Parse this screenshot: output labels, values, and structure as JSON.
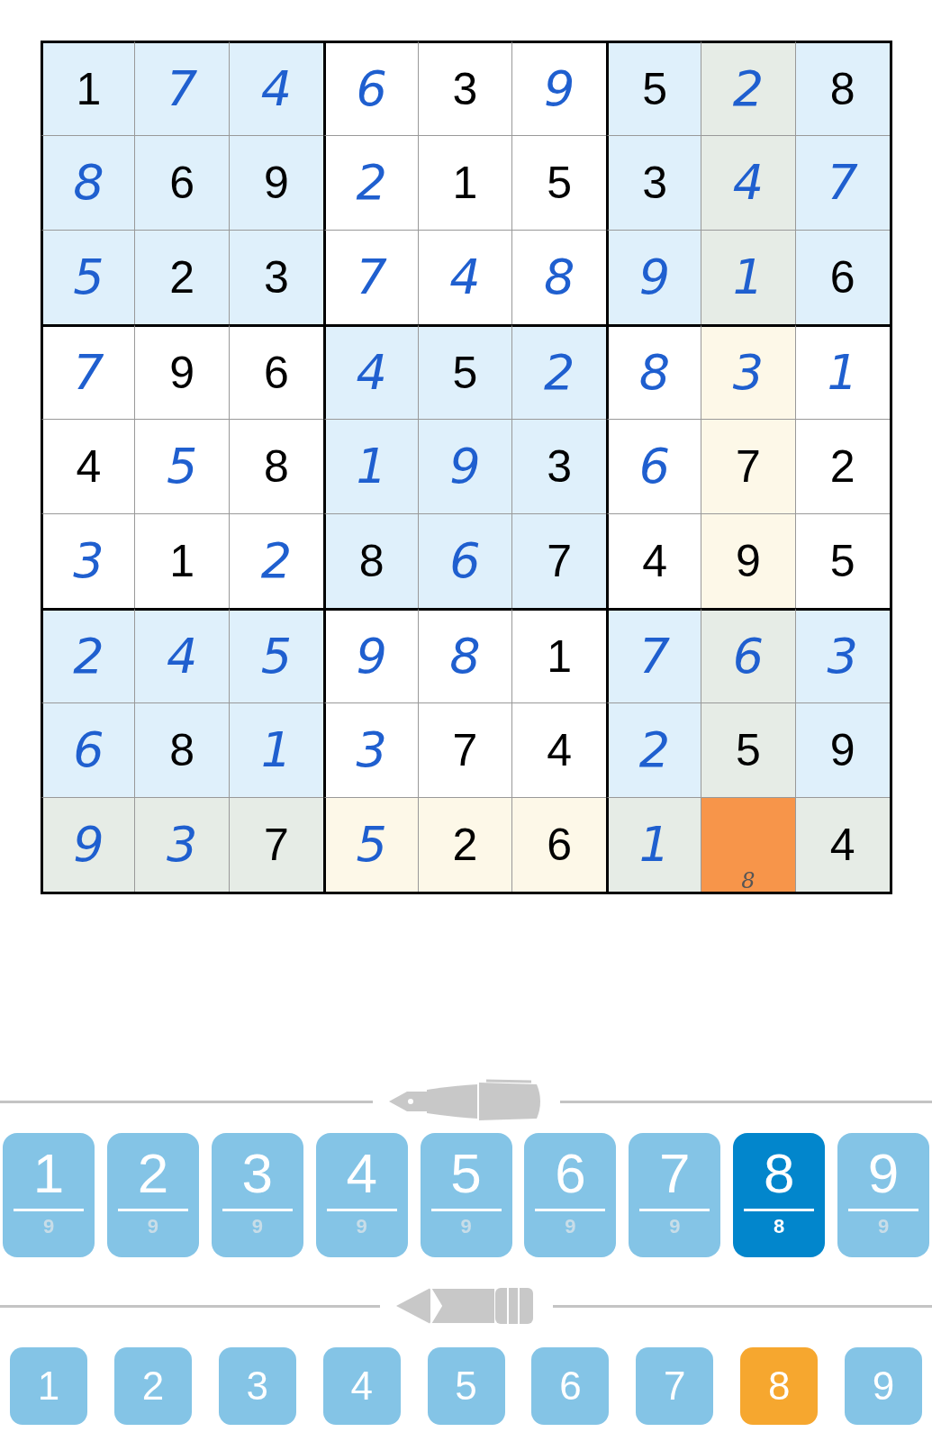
{
  "grid": {
    "rows": [
      {
        "cells": [
          {
            "value": "1",
            "kind": "given",
            "color": "#dff0fb"
          },
          {
            "value": "7",
            "kind": "entered",
            "color": "#dff0fb"
          },
          {
            "value": "4",
            "kind": "entered",
            "color": "#dff0fb"
          },
          {
            "value": "6",
            "kind": "entered",
            "color": "#ffffff"
          },
          {
            "value": "3",
            "kind": "given",
            "color": "#ffffff"
          },
          {
            "value": "9",
            "kind": "entered",
            "color": "#ffffff"
          },
          {
            "value": "5",
            "kind": "given",
            "color": "#dff0fb"
          },
          {
            "value": "2",
            "kind": "entered",
            "color": "#e6ece6"
          },
          {
            "value": "8",
            "kind": "given",
            "color": "#dff0fb"
          }
        ]
      },
      {
        "cells": [
          {
            "value": "8",
            "kind": "entered",
            "color": "#dff0fb"
          },
          {
            "value": "6",
            "kind": "given",
            "color": "#dff0fb"
          },
          {
            "value": "9",
            "kind": "given",
            "color": "#dff0fb"
          },
          {
            "value": "2",
            "kind": "entered",
            "color": "#ffffff"
          },
          {
            "value": "1",
            "kind": "given",
            "color": "#ffffff"
          },
          {
            "value": "5",
            "kind": "given",
            "color": "#ffffff"
          },
          {
            "value": "3",
            "kind": "given",
            "color": "#dff0fb"
          },
          {
            "value": "4",
            "kind": "entered",
            "color": "#e6ece6"
          },
          {
            "value": "7",
            "kind": "entered",
            "color": "#dff0fb"
          }
        ]
      },
      {
        "cells": [
          {
            "value": "5",
            "kind": "entered",
            "color": "#dff0fb"
          },
          {
            "value": "2",
            "kind": "given",
            "color": "#dff0fb"
          },
          {
            "value": "3",
            "kind": "given",
            "color": "#dff0fb"
          },
          {
            "value": "7",
            "kind": "entered",
            "color": "#ffffff"
          },
          {
            "value": "4",
            "kind": "entered",
            "color": "#ffffff"
          },
          {
            "value": "8",
            "kind": "entered",
            "color": "#ffffff"
          },
          {
            "value": "9",
            "kind": "entered",
            "color": "#dff0fb"
          },
          {
            "value": "1",
            "kind": "entered",
            "color": "#e6ece6"
          },
          {
            "value": "6",
            "kind": "given",
            "color": "#dff0fb"
          }
        ]
      },
      {
        "cells": [
          {
            "value": "7",
            "kind": "entered",
            "color": "#ffffff"
          },
          {
            "value": "9",
            "kind": "given",
            "color": "#ffffff"
          },
          {
            "value": "6",
            "kind": "given",
            "color": "#ffffff"
          },
          {
            "value": "4",
            "kind": "entered",
            "color": "#dff0fb"
          },
          {
            "value": "5",
            "kind": "given",
            "color": "#dff0fb"
          },
          {
            "value": "2",
            "kind": "entered",
            "color": "#dff0fb"
          },
          {
            "value": "8",
            "kind": "entered",
            "color": "#ffffff"
          },
          {
            "value": "3",
            "kind": "entered",
            "color": "#fdf8e8"
          },
          {
            "value": "1",
            "kind": "entered",
            "color": "#ffffff"
          }
        ]
      },
      {
        "cells": [
          {
            "value": "4",
            "kind": "given",
            "color": "#ffffff"
          },
          {
            "value": "5",
            "kind": "entered",
            "color": "#ffffff"
          },
          {
            "value": "8",
            "kind": "given",
            "color": "#ffffff"
          },
          {
            "value": "1",
            "kind": "entered",
            "color": "#dff0fb"
          },
          {
            "value": "9",
            "kind": "entered",
            "color": "#dff0fb"
          },
          {
            "value": "3",
            "kind": "given",
            "color": "#dff0fb"
          },
          {
            "value": "6",
            "kind": "entered",
            "color": "#ffffff"
          },
          {
            "value": "7",
            "kind": "given",
            "color": "#fdf8e8"
          },
          {
            "value": "2",
            "kind": "given",
            "color": "#ffffff"
          }
        ]
      },
      {
        "cells": [
          {
            "value": "3",
            "kind": "entered",
            "color": "#ffffff"
          },
          {
            "value": "1",
            "kind": "given",
            "color": "#ffffff"
          },
          {
            "value": "2",
            "kind": "entered",
            "color": "#ffffff"
          },
          {
            "value": "8",
            "kind": "given",
            "color": "#dff0fb"
          },
          {
            "value": "6",
            "kind": "entered",
            "color": "#dff0fb"
          },
          {
            "value": "7",
            "kind": "given",
            "color": "#dff0fb"
          },
          {
            "value": "4",
            "kind": "given",
            "color": "#ffffff"
          },
          {
            "value": "9",
            "kind": "given",
            "color": "#fdf8e8"
          },
          {
            "value": "5",
            "kind": "given",
            "color": "#ffffff"
          }
        ]
      },
      {
        "cells": [
          {
            "value": "2",
            "kind": "entered",
            "color": "#dff0fb"
          },
          {
            "value": "4",
            "kind": "entered",
            "color": "#dff0fb"
          },
          {
            "value": "5",
            "kind": "entered",
            "color": "#dff0fb"
          },
          {
            "value": "9",
            "kind": "entered",
            "color": "#ffffff"
          },
          {
            "value": "8",
            "kind": "entered",
            "color": "#ffffff"
          },
          {
            "value": "1",
            "kind": "given",
            "color": "#ffffff"
          },
          {
            "value": "7",
            "kind": "entered",
            "color": "#dff0fb"
          },
          {
            "value": "6",
            "kind": "entered",
            "color": "#e6ece6"
          },
          {
            "value": "3",
            "kind": "entered",
            "color": "#dff0fb"
          }
        ]
      },
      {
        "cells": [
          {
            "value": "6",
            "kind": "entered",
            "color": "#dff0fb"
          },
          {
            "value": "8",
            "kind": "given",
            "color": "#dff0fb"
          },
          {
            "value": "1",
            "kind": "entered",
            "color": "#dff0fb"
          },
          {
            "value": "3",
            "kind": "entered",
            "color": "#ffffff"
          },
          {
            "value": "7",
            "kind": "given",
            "color": "#ffffff"
          },
          {
            "value": "4",
            "kind": "given",
            "color": "#ffffff"
          },
          {
            "value": "2",
            "kind": "entered",
            "color": "#dff0fb"
          },
          {
            "value": "5",
            "kind": "given",
            "color": "#e6ece6"
          },
          {
            "value": "9",
            "kind": "given",
            "color": "#dff0fb"
          }
        ]
      },
      {
        "cells": [
          {
            "value": "9",
            "kind": "entered",
            "color": "#e6ece6"
          },
          {
            "value": "3",
            "kind": "entered",
            "color": "#e6ece6"
          },
          {
            "value": "7",
            "kind": "given",
            "color": "#e6ece6"
          },
          {
            "value": "5",
            "kind": "entered",
            "color": "#fdf8e8"
          },
          {
            "value": "2",
            "kind": "given",
            "color": "#fdf8e8"
          },
          {
            "value": "6",
            "kind": "given",
            "color": "#fdf8e8"
          },
          {
            "value": "1",
            "kind": "entered",
            "color": "#e6ece6"
          },
          {
            "note": "8",
            "kind": "empty",
            "color": "#f7954a"
          },
          {
            "value": "4",
            "kind": "given",
            "color": "#e6ece6"
          }
        ]
      }
    ]
  },
  "pen_buttons": [
    {
      "digit": "1",
      "count": "9",
      "selected": false
    },
    {
      "digit": "2",
      "count": "9",
      "selected": false
    },
    {
      "digit": "3",
      "count": "9",
      "selected": false
    },
    {
      "digit": "4",
      "count": "9",
      "selected": false
    },
    {
      "digit": "5",
      "count": "9",
      "selected": false
    },
    {
      "digit": "6",
      "count": "9",
      "selected": false
    },
    {
      "digit": "7",
      "count": "9",
      "selected": false
    },
    {
      "digit": "8",
      "count": "8",
      "selected": true
    },
    {
      "digit": "9",
      "count": "9",
      "selected": false
    }
  ],
  "pencil_buttons": [
    {
      "digit": "1",
      "selected": false
    },
    {
      "digit": "2",
      "selected": false
    },
    {
      "digit": "3",
      "selected": false
    },
    {
      "digit": "4",
      "selected": false
    },
    {
      "digit": "5",
      "selected": false
    },
    {
      "digit": "6",
      "selected": false
    },
    {
      "digit": "7",
      "selected": false
    },
    {
      "digit": "8",
      "selected": true
    },
    {
      "digit": "9",
      "selected": false
    }
  ]
}
